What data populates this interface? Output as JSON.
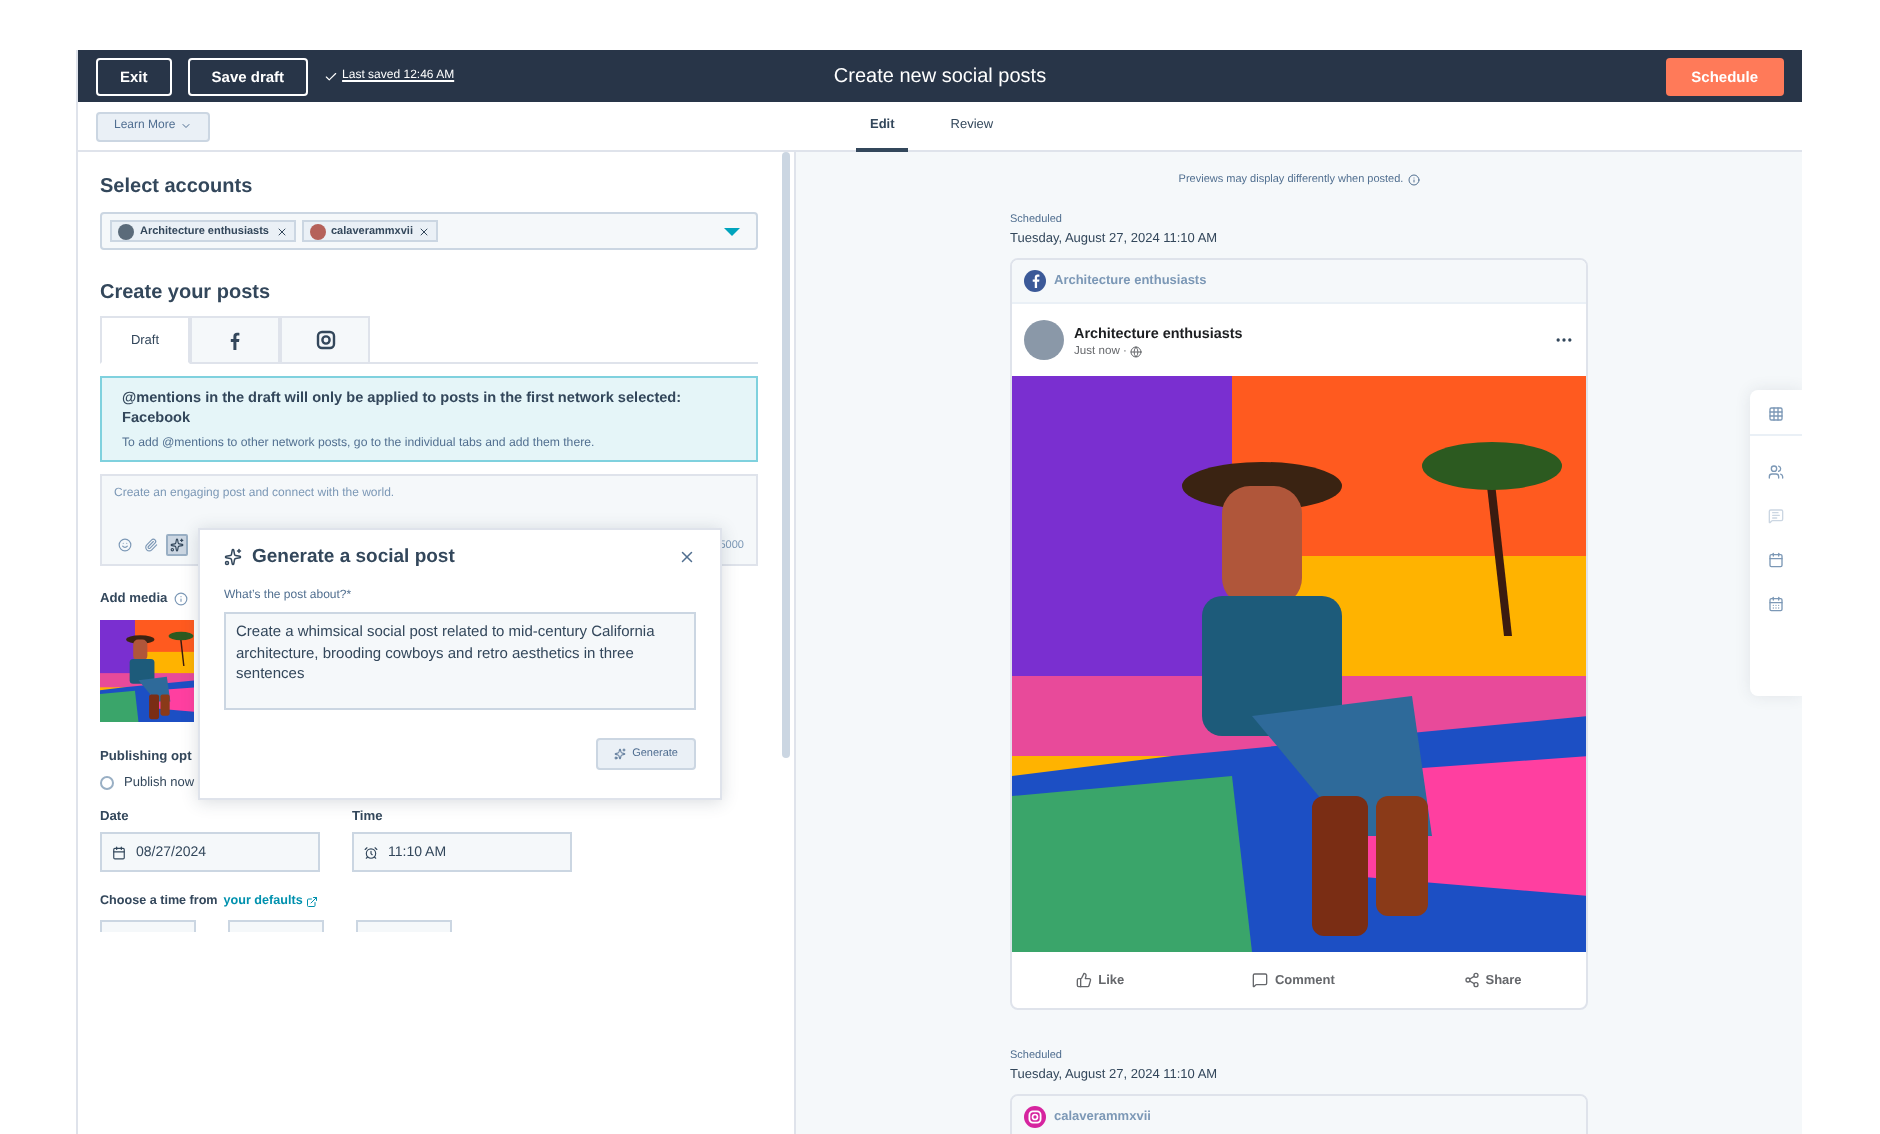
{
  "header": {
    "buttons": [
      {
        "label": "Exit"
      },
      {
        "label": "Save draft"
      }
    ],
    "last_saved": "Last saved 12:46 AM",
    "title": "Create new social posts",
    "schedule_button": "Schedule"
  },
  "learn_more": "Learn More",
  "tabs": [
    {
      "label": "Edit",
      "selected": true
    },
    {
      "label": "Review",
      "selected": false
    }
  ],
  "select_accounts": {
    "heading": "Select accounts",
    "chips": [
      {
        "label": "Architecture enthusiasts",
        "kind": "facebook"
      },
      {
        "label": "calaverammxvii",
        "kind": "instagram"
      }
    ]
  },
  "create_posts": {
    "heading": "Create your posts",
    "tabs": [
      {
        "kind": "text",
        "label": "Draft",
        "selected": true
      },
      {
        "kind": "facebook",
        "selected": false
      },
      {
        "kind": "instagram",
        "selected": false
      }
    ],
    "notice": {
      "title": "@mentions in the draft will only be applied to posts in the first network selected: Facebook",
      "body": "To add @mentions to other network posts, go to the individual tabs and add them there."
    },
    "composer": {
      "placeholder": "Create an engaging post and connect with the world.",
      "counter": "5000"
    }
  },
  "add_media": {
    "label": "Add media"
  },
  "publishing": {
    "label": "Publishing opt",
    "option": "Publish now",
    "checked": false
  },
  "date": {
    "label": "Date",
    "value": "08/27/2024"
  },
  "time": {
    "label": "Time",
    "value": "11:10 AM"
  },
  "defaults": {
    "text": "Choose a time from",
    "link": "your defaults"
  },
  "popup": {
    "title": "Generate a social post",
    "prompt_label": "What’s the post about?*",
    "prompt": "Create a whimsical social post related to mid-century California architecture, brooding cowboys and retro aesthetics in three sentences",
    "button": "Generate"
  },
  "preview": {
    "note": "Previews may display differently when posted.",
    "posts": [
      {
        "kind": "facebook",
        "status": "Scheduled",
        "datetime": "Tuesday, August 27, 2024 11:10 AM",
        "account": "Architecture enthusiasts",
        "author": "Architecture enthusiasts",
        "time": "Just now ·",
        "actions": [
          "Like",
          "Comment",
          "Share"
        ]
      },
      {
        "kind": "instagram",
        "status": "Scheduled",
        "datetime": "Tuesday, August 27, 2024 11:10 AM",
        "account": "calaverammxvii"
      }
    ]
  }
}
